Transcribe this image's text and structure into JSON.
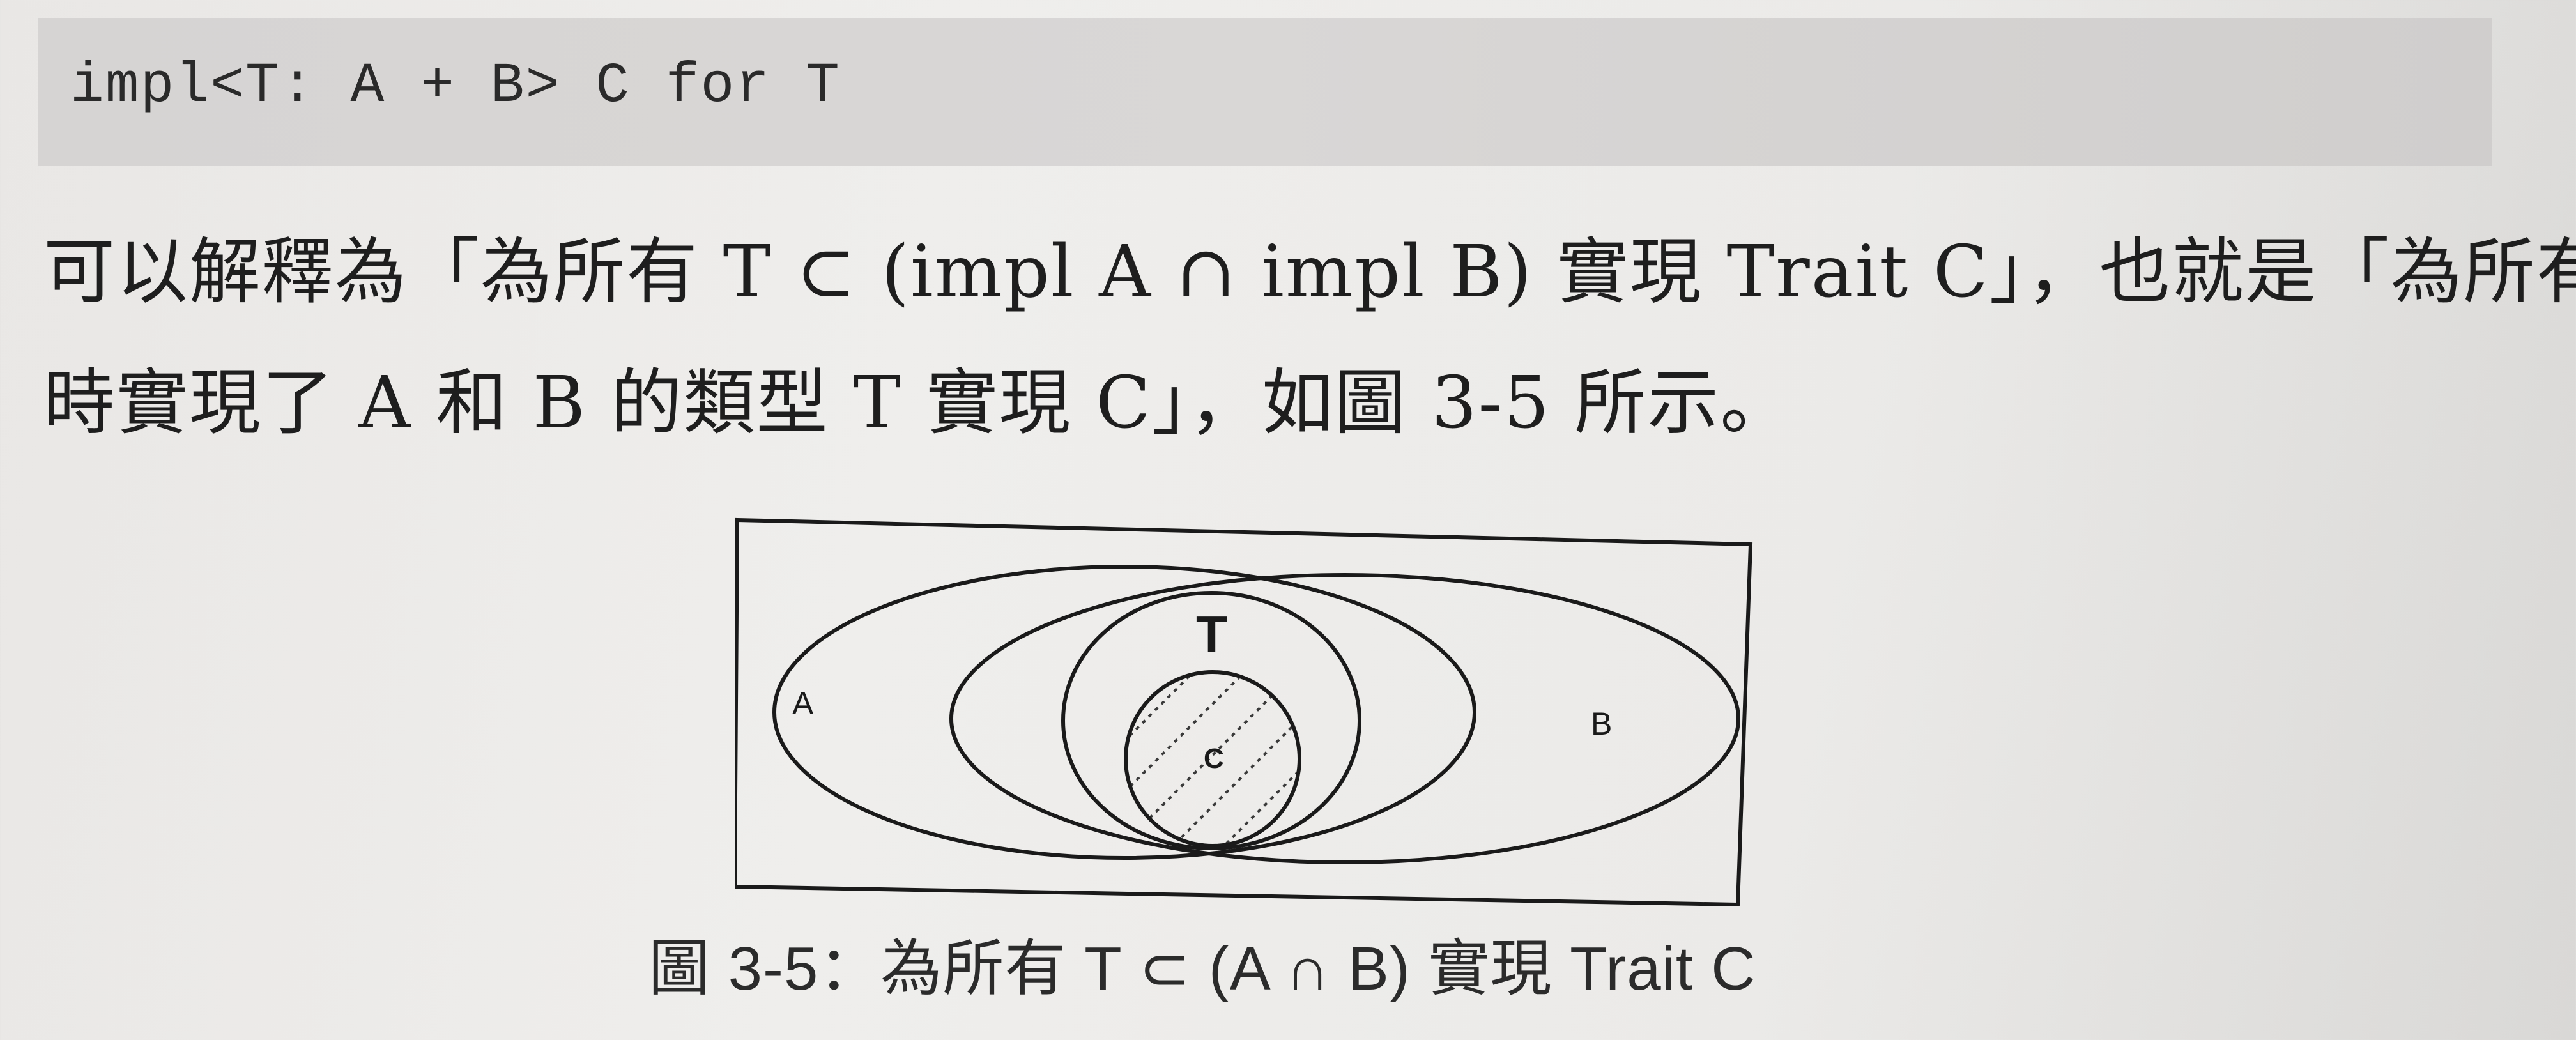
{
  "code": {
    "text": "impl<T: A + B> C for T"
  },
  "paragraph": {
    "line1": "可以解釋為「為所有 T ⊂ (impl A ∩ impl B) 實現 Trait C」，也就是「為所有同",
    "line2": "時實現了 A 和 B 的類型 T 實現 C」，如圖 3-5 所示。"
  },
  "figure": {
    "label_a": "A",
    "label_b": "B",
    "label_t": "T",
    "label_c": "C",
    "caption": "圖 3-5：為所有 T ⊂ (A ∩ B) 實現 Trait C",
    "colors": {
      "stroke": "#1a1a1a",
      "hatch": "#3a3a3a"
    }
  }
}
